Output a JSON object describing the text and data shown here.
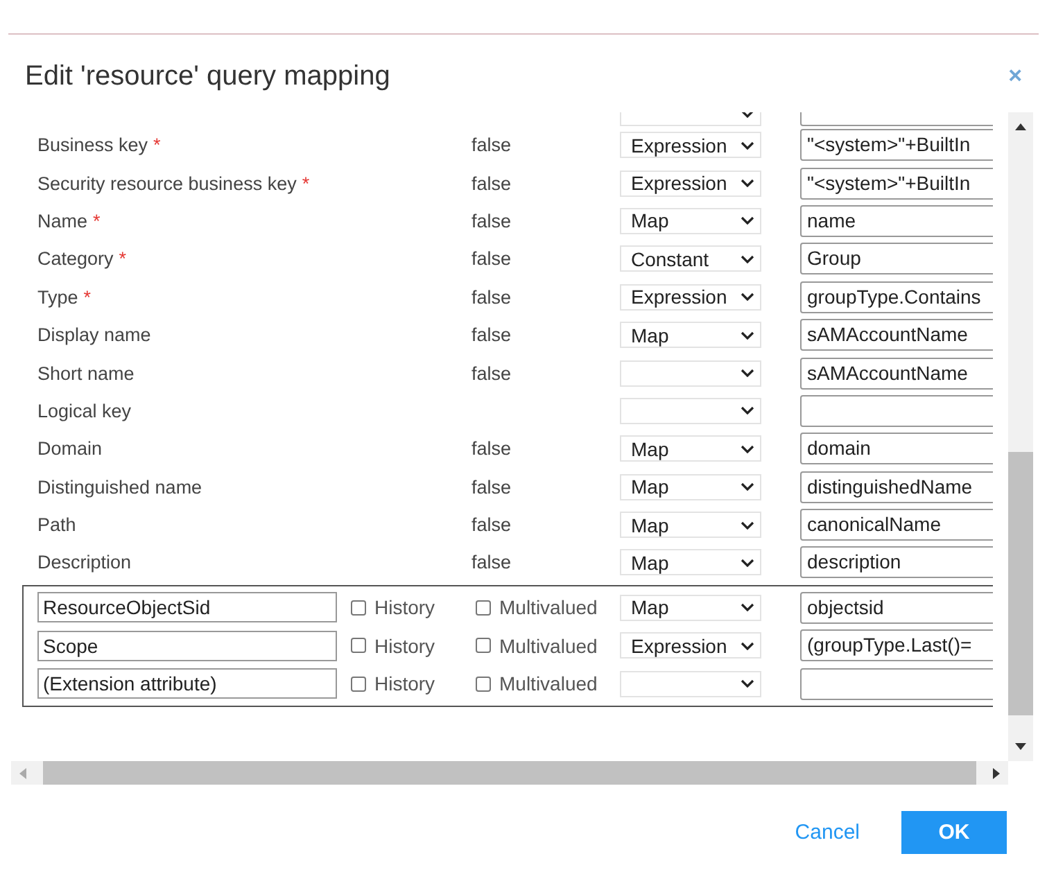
{
  "dialog": {
    "title": "Edit 'resource' query mapping",
    "close": "×"
  },
  "rows": [
    {
      "label": "Business key",
      "required_mark": "*",
      "history": "false",
      "mapping": "Expression",
      "value": "\"<system>\"+BuiltIn"
    },
    {
      "label": "Security resource business key",
      "required_mark": "*",
      "history": "false",
      "mapping": "Expression",
      "value": "\"<system>\"+BuiltIn"
    },
    {
      "label": "Name",
      "required_mark": "*",
      "history": "false",
      "mapping": "Map",
      "value": "name"
    },
    {
      "label": "Category",
      "required_mark": "*",
      "history": "false",
      "mapping": "Constant",
      "value": "Group"
    },
    {
      "label": "Type",
      "required_mark": "*",
      "history": "false",
      "mapping": "Expression",
      "value": "groupType.Contains"
    },
    {
      "label": "Display name",
      "history": "false",
      "mapping": "Map",
      "value": "sAMAccountName"
    },
    {
      "label": "Short name",
      "history": "false",
      "mapping": "",
      "value": "sAMAccountName"
    },
    {
      "label": "Logical key",
      "history": "",
      "mapping": "",
      "value": ""
    },
    {
      "label": "Domain",
      "history": "false",
      "mapping": "Map",
      "value": "domain"
    },
    {
      "label": "Distinguished name",
      "history": "false",
      "mapping": "Map",
      "value": "distinguishedName"
    },
    {
      "label": "Path",
      "history": "false",
      "mapping": "Map",
      "value": "canonicalName"
    },
    {
      "label": "Description",
      "history": "false",
      "mapping": "Map",
      "value": "description"
    }
  ],
  "custom_rows": [
    {
      "name": "ResourceObjectSid",
      "history_label": "History",
      "history": false,
      "multivalued_label": "Multivalued",
      "multivalued": false,
      "mapping": "Map",
      "value": "objectsid"
    },
    {
      "name": "Scope",
      "history_label": "History",
      "history": false,
      "multivalued_label": "Multivalued",
      "multivalued": false,
      "mapping": "Expression",
      "value": "(groupType.Last()="
    },
    {
      "name": "(Extension attribute)",
      "history_label": "History",
      "history": false,
      "multivalued_label": "Multivalued",
      "multivalued": false,
      "mapping": "",
      "value": ""
    }
  ],
  "buttons": {
    "cancel": "Cancel",
    "ok": "OK"
  }
}
